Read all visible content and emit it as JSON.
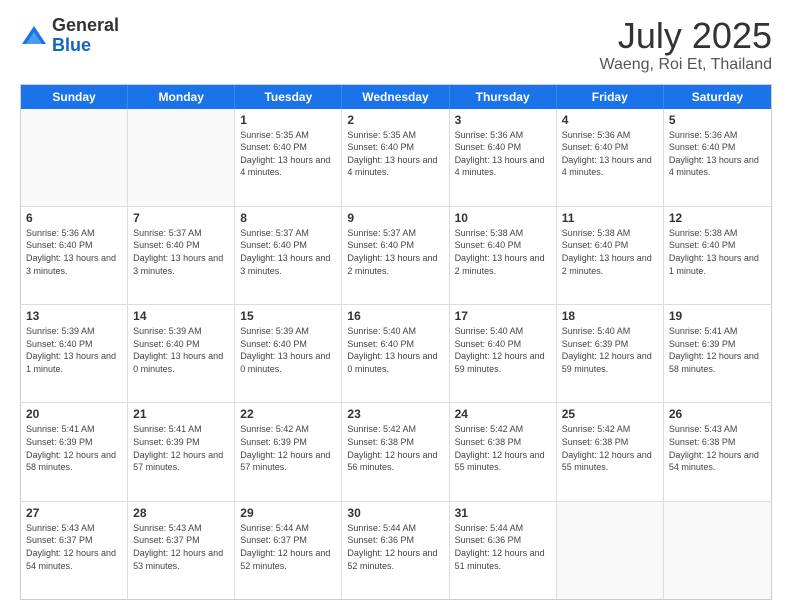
{
  "header": {
    "logo_general": "General",
    "logo_blue": "Blue",
    "title": "July 2025",
    "subtitle": "Waeng, Roi Et, Thailand"
  },
  "days_of_week": [
    "Sunday",
    "Monday",
    "Tuesday",
    "Wednesday",
    "Thursday",
    "Friday",
    "Saturday"
  ],
  "weeks": [
    [
      {
        "day": "",
        "sunrise": "",
        "sunset": "",
        "daylight": ""
      },
      {
        "day": "",
        "sunrise": "",
        "sunset": "",
        "daylight": ""
      },
      {
        "day": "1",
        "sunrise": "Sunrise: 5:35 AM",
        "sunset": "Sunset: 6:40 PM",
        "daylight": "Daylight: 13 hours and 4 minutes."
      },
      {
        "day": "2",
        "sunrise": "Sunrise: 5:35 AM",
        "sunset": "Sunset: 6:40 PM",
        "daylight": "Daylight: 13 hours and 4 minutes."
      },
      {
        "day": "3",
        "sunrise": "Sunrise: 5:36 AM",
        "sunset": "Sunset: 6:40 PM",
        "daylight": "Daylight: 13 hours and 4 minutes."
      },
      {
        "day": "4",
        "sunrise": "Sunrise: 5:36 AM",
        "sunset": "Sunset: 6:40 PM",
        "daylight": "Daylight: 13 hours and 4 minutes."
      },
      {
        "day": "5",
        "sunrise": "Sunrise: 5:36 AM",
        "sunset": "Sunset: 6:40 PM",
        "daylight": "Daylight: 13 hours and 4 minutes."
      }
    ],
    [
      {
        "day": "6",
        "sunrise": "Sunrise: 5:36 AM",
        "sunset": "Sunset: 6:40 PM",
        "daylight": "Daylight: 13 hours and 3 minutes."
      },
      {
        "day": "7",
        "sunrise": "Sunrise: 5:37 AM",
        "sunset": "Sunset: 6:40 PM",
        "daylight": "Daylight: 13 hours and 3 minutes."
      },
      {
        "day": "8",
        "sunrise": "Sunrise: 5:37 AM",
        "sunset": "Sunset: 6:40 PM",
        "daylight": "Daylight: 13 hours and 3 minutes."
      },
      {
        "day": "9",
        "sunrise": "Sunrise: 5:37 AM",
        "sunset": "Sunset: 6:40 PM",
        "daylight": "Daylight: 13 hours and 2 minutes."
      },
      {
        "day": "10",
        "sunrise": "Sunrise: 5:38 AM",
        "sunset": "Sunset: 6:40 PM",
        "daylight": "Daylight: 13 hours and 2 minutes."
      },
      {
        "day": "11",
        "sunrise": "Sunrise: 5:38 AM",
        "sunset": "Sunset: 6:40 PM",
        "daylight": "Daylight: 13 hours and 2 minutes."
      },
      {
        "day": "12",
        "sunrise": "Sunrise: 5:38 AM",
        "sunset": "Sunset: 6:40 PM",
        "daylight": "Daylight: 13 hours and 1 minute."
      }
    ],
    [
      {
        "day": "13",
        "sunrise": "Sunrise: 5:39 AM",
        "sunset": "Sunset: 6:40 PM",
        "daylight": "Daylight: 13 hours and 1 minute."
      },
      {
        "day": "14",
        "sunrise": "Sunrise: 5:39 AM",
        "sunset": "Sunset: 6:40 PM",
        "daylight": "Daylight: 13 hours and 0 minutes."
      },
      {
        "day": "15",
        "sunrise": "Sunrise: 5:39 AM",
        "sunset": "Sunset: 6:40 PM",
        "daylight": "Daylight: 13 hours and 0 minutes."
      },
      {
        "day": "16",
        "sunrise": "Sunrise: 5:40 AM",
        "sunset": "Sunset: 6:40 PM",
        "daylight": "Daylight: 13 hours and 0 minutes."
      },
      {
        "day": "17",
        "sunrise": "Sunrise: 5:40 AM",
        "sunset": "Sunset: 6:40 PM",
        "daylight": "Daylight: 12 hours and 59 minutes."
      },
      {
        "day": "18",
        "sunrise": "Sunrise: 5:40 AM",
        "sunset": "Sunset: 6:39 PM",
        "daylight": "Daylight: 12 hours and 59 minutes."
      },
      {
        "day": "19",
        "sunrise": "Sunrise: 5:41 AM",
        "sunset": "Sunset: 6:39 PM",
        "daylight": "Daylight: 12 hours and 58 minutes."
      }
    ],
    [
      {
        "day": "20",
        "sunrise": "Sunrise: 5:41 AM",
        "sunset": "Sunset: 6:39 PM",
        "daylight": "Daylight: 12 hours and 58 minutes."
      },
      {
        "day": "21",
        "sunrise": "Sunrise: 5:41 AM",
        "sunset": "Sunset: 6:39 PM",
        "daylight": "Daylight: 12 hours and 57 minutes."
      },
      {
        "day": "22",
        "sunrise": "Sunrise: 5:42 AM",
        "sunset": "Sunset: 6:39 PM",
        "daylight": "Daylight: 12 hours and 57 minutes."
      },
      {
        "day": "23",
        "sunrise": "Sunrise: 5:42 AM",
        "sunset": "Sunset: 6:38 PM",
        "daylight": "Daylight: 12 hours and 56 minutes."
      },
      {
        "day": "24",
        "sunrise": "Sunrise: 5:42 AM",
        "sunset": "Sunset: 6:38 PM",
        "daylight": "Daylight: 12 hours and 55 minutes."
      },
      {
        "day": "25",
        "sunrise": "Sunrise: 5:42 AM",
        "sunset": "Sunset: 6:38 PM",
        "daylight": "Daylight: 12 hours and 55 minutes."
      },
      {
        "day": "26",
        "sunrise": "Sunrise: 5:43 AM",
        "sunset": "Sunset: 6:38 PM",
        "daylight": "Daylight: 12 hours and 54 minutes."
      }
    ],
    [
      {
        "day": "27",
        "sunrise": "Sunrise: 5:43 AM",
        "sunset": "Sunset: 6:37 PM",
        "daylight": "Daylight: 12 hours and 54 minutes."
      },
      {
        "day": "28",
        "sunrise": "Sunrise: 5:43 AM",
        "sunset": "Sunset: 6:37 PM",
        "daylight": "Daylight: 12 hours and 53 minutes."
      },
      {
        "day": "29",
        "sunrise": "Sunrise: 5:44 AM",
        "sunset": "Sunset: 6:37 PM",
        "daylight": "Daylight: 12 hours and 52 minutes."
      },
      {
        "day": "30",
        "sunrise": "Sunrise: 5:44 AM",
        "sunset": "Sunset: 6:36 PM",
        "daylight": "Daylight: 12 hours and 52 minutes."
      },
      {
        "day": "31",
        "sunrise": "Sunrise: 5:44 AM",
        "sunset": "Sunset: 6:36 PM",
        "daylight": "Daylight: 12 hours and 51 minutes."
      },
      {
        "day": "",
        "sunrise": "",
        "sunset": "",
        "daylight": ""
      },
      {
        "day": "",
        "sunrise": "",
        "sunset": "",
        "daylight": ""
      }
    ]
  ]
}
